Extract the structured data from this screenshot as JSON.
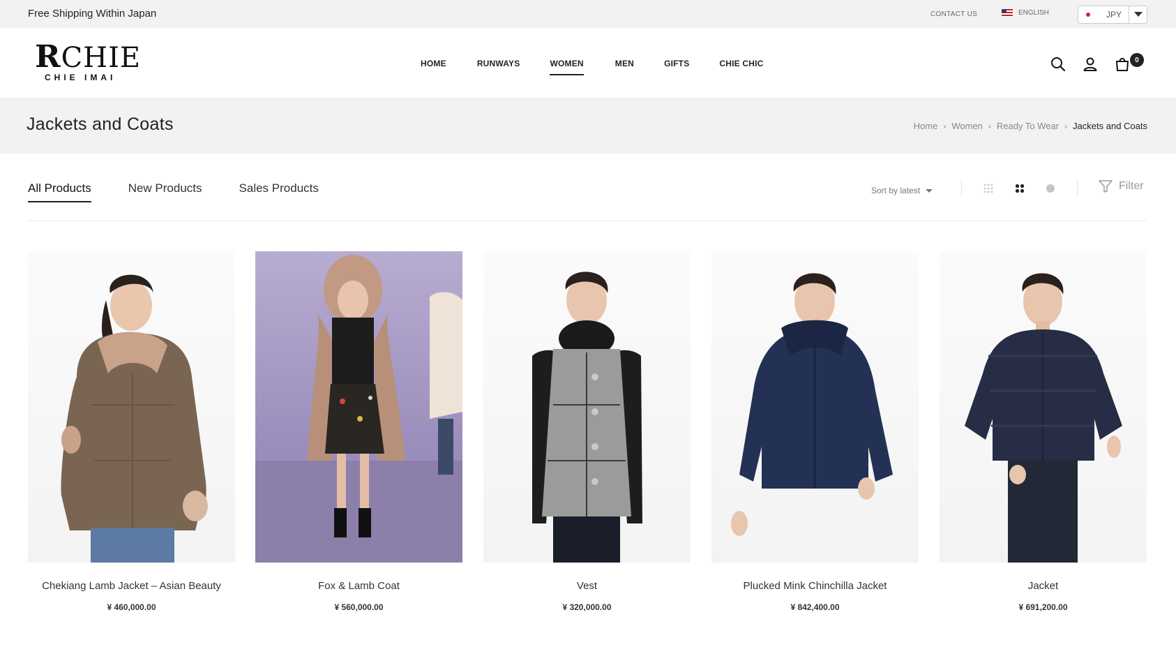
{
  "topbar": {
    "shipping": "Free Shipping Within Japan",
    "contact": "CONTACT US",
    "language": "ENGLISH",
    "currency": "JPY"
  },
  "brand": {
    "logo_main": "CHIE",
    "logo_sub": "CHIE IMAI"
  },
  "nav": {
    "items": [
      {
        "label": "HOME"
      },
      {
        "label": "RUNWAYS"
      },
      {
        "label": "WOMEN"
      },
      {
        "label": "MEN"
      },
      {
        "label": "GIFTS"
      },
      {
        "label": "CHIE CHIC"
      }
    ],
    "active": "WOMEN"
  },
  "header": {
    "cart_count": "0",
    "icons": [
      "search-icon",
      "account-icon",
      "cart-icon"
    ]
  },
  "page": {
    "title": "Jackets and Coats",
    "breadcrumb": [
      "Home",
      "Women",
      "Ready To Wear",
      "Jackets and Coats"
    ]
  },
  "filters": {
    "tabs": [
      {
        "label": "All Products"
      },
      {
        "label": "New Products"
      },
      {
        "label": "Sales Products"
      }
    ],
    "active_tab": "All Products",
    "sort_label": "Sort by latest",
    "filter_label": "Filter"
  },
  "products": [
    {
      "name": "Chekiang Lamb Jacket – Asian Beauty",
      "price": "¥ 460,000.00"
    },
    {
      "name": "Fox & Lamb Coat",
      "price": "¥ 560,000.00"
    },
    {
      "name": "Vest",
      "price": "¥ 320,000.00"
    },
    {
      "name": "Plucked Mink Chinchilla Jacket",
      "price": "¥ 842,400.00"
    },
    {
      "name": "Jacket",
      "price": "¥ 691,200.00"
    }
  ],
  "colors": {
    "band": "#f2f2f3",
    "text": "#222222",
    "muted": "#888888"
  }
}
